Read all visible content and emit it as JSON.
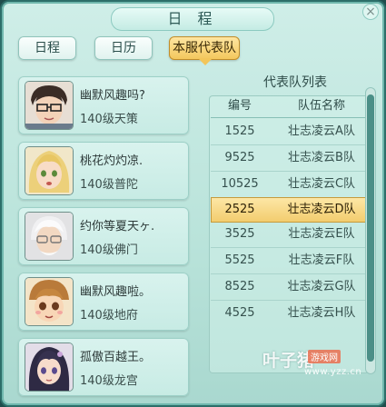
{
  "window": {
    "title": "日 程",
    "close_label": "×"
  },
  "tabs": [
    {
      "label": "日程",
      "active": false
    },
    {
      "label": "日历",
      "active": false
    },
    {
      "label": "本服代表队",
      "active": true
    }
  ],
  "members": [
    {
      "name": "幽默风趣吗?",
      "level": "140级天策",
      "avatar_icon": "avatar-glasses-man-icon"
    },
    {
      "name": "桃花灼灼凉.",
      "level": "140级普陀",
      "avatar_icon": "avatar-blonde-girl-icon"
    },
    {
      "name": "约你等夏天ヶ.",
      "level": "140级佛门",
      "avatar_icon": "avatar-elder-icon"
    },
    {
      "name": "幽默风趣啦。",
      "level": "140级地府",
      "avatar_icon": "avatar-child-icon"
    },
    {
      "name": "孤傲百越王。",
      "level": "140级龙宫",
      "avatar_icon": "avatar-dark-hair-girl-icon"
    }
  ],
  "team_list": {
    "title": "代表队列表",
    "headers": {
      "number": "编号",
      "team_name": "队伍名称"
    },
    "rows": [
      {
        "number": "1525",
        "team": "壮志凌云A队",
        "selected": false
      },
      {
        "number": "9525",
        "team": "壮志凌云B队",
        "selected": false
      },
      {
        "number": "10525",
        "team": "壮志凌云C队",
        "selected": false
      },
      {
        "number": "2525",
        "team": "壮志凌云D队",
        "selected": true
      },
      {
        "number": "3525",
        "team": "壮志凌云E队",
        "selected": false
      },
      {
        "number": "5525",
        "team": "壮志凌云F队",
        "selected": false
      },
      {
        "number": "8525",
        "team": "壮志凌云G队",
        "selected": false
      },
      {
        "number": "4525",
        "team": "壮志凌云H队",
        "selected": false
      }
    ]
  },
  "watermark": {
    "main": "叶子猪",
    "badge": "游戏网",
    "url": "www.yzz.cn"
  },
  "colors": {
    "panel_bg": "#c7ebe4",
    "active_tab": "#f3c65a",
    "selected_row": "#f2cc6c",
    "scroll_thumb": "#4b8f87"
  }
}
